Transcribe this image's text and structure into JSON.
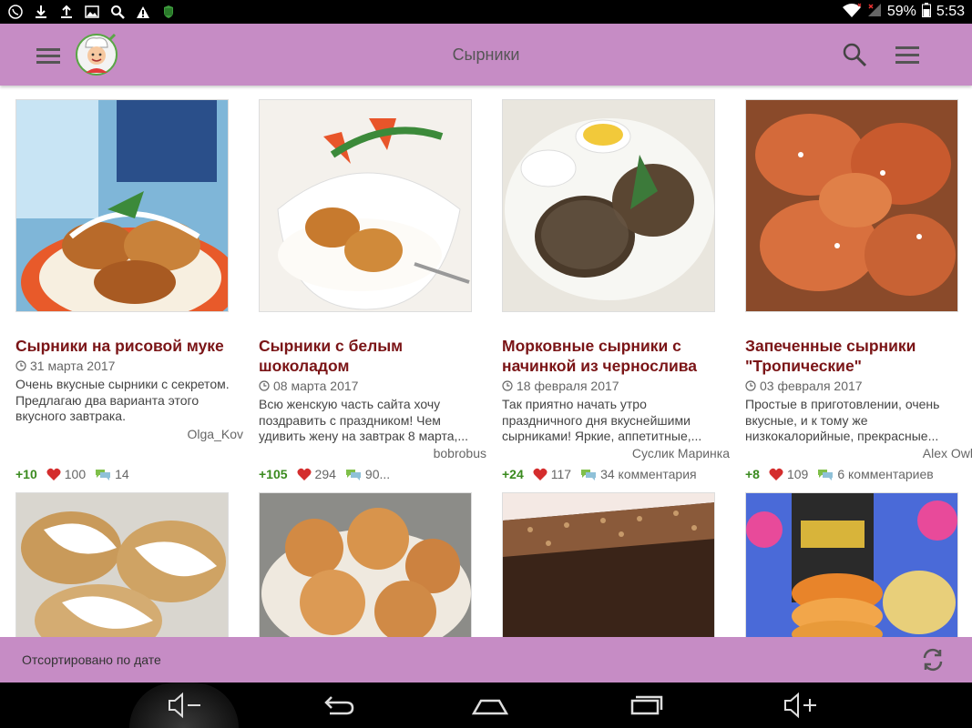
{
  "status": {
    "battery": "59%",
    "time": "5:53",
    "left_icons": [
      "viber-icon",
      "download-icon",
      "upload-icon",
      "image-icon",
      "search-icon",
      "warning-icon",
      "shield-icon"
    ]
  },
  "appbar": {
    "title": "Сырники"
  },
  "recipes": [
    {
      "title": "Сырники на рисовой муке",
      "date": "31 марта 2017",
      "desc": "Очень вкусные сырники с секретом. Предлагаю два варианта этого вкусного завтрака.",
      "author": "Olga_Kov",
      "plus": "+10",
      "likes": "100",
      "comments": "14"
    },
    {
      "title": "Сырники с белым шоколадом",
      "date": "08 марта 2017",
      "desc": "Всю женскую часть сайта хочу поздравить с праздником! Чем удивить жену на завтрак 8 марта,...",
      "author": "bobrobus",
      "plus": "+105",
      "likes": "294",
      "comments": "90..."
    },
    {
      "title": "Морковные сырники с начинкой из чернослива",
      "date": "18 февраля 2017",
      "desc": "Так приятно начать утро праздничного дня вкуснейшими сырниками! Яркие, аппетитные,...",
      "author": "Суслик Маринка",
      "plus": "+24",
      "likes": "117",
      "comments": "34 комментария"
    },
    {
      "title": "Запеченные сырники \"Тропические\"",
      "date": "03 февраля 2017",
      "desc": "Простые в приготовлении, очень вкусные, и к тому же низкокалорийные, прекрасные...",
      "author": "Alex Owl",
      "plus": "+8",
      "likes": "109",
      "comments": "6 комментариев"
    }
  ],
  "sortbar": {
    "label": "Отсортировано по дате"
  },
  "colors": {
    "accent": "#c68cc5",
    "title": "#7a1416",
    "plus": "#3a8a1e"
  }
}
